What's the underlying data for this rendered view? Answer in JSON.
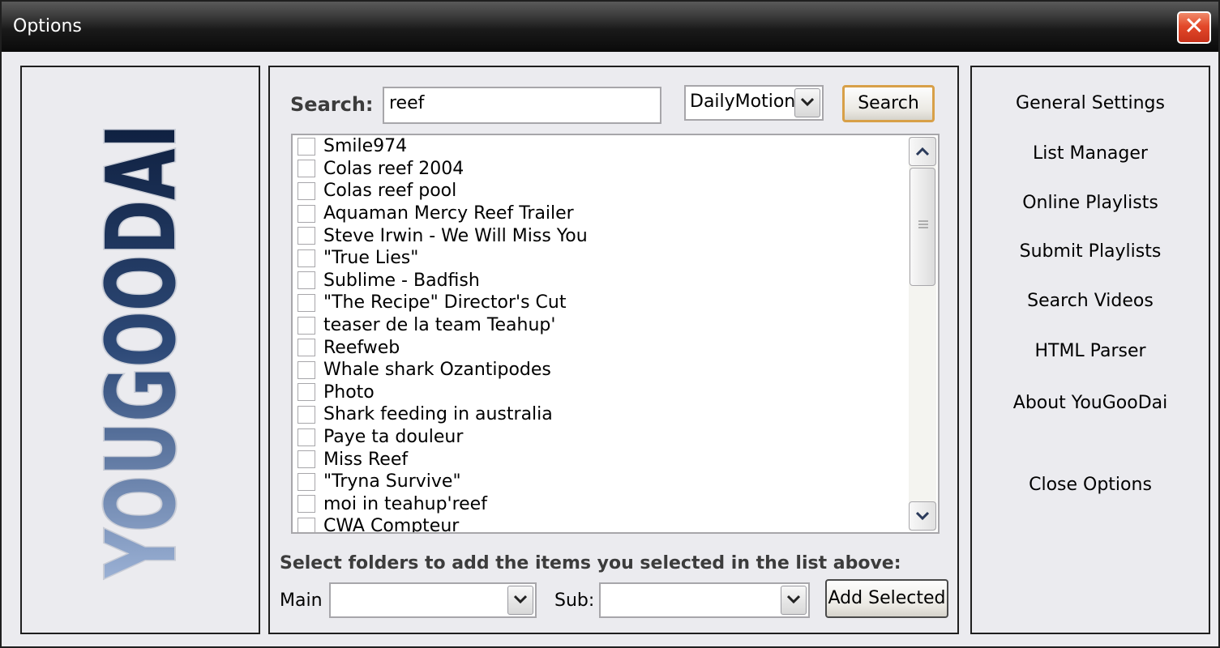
{
  "window": {
    "title": "Options"
  },
  "logo": {
    "text": "YOUGOODAI"
  },
  "search": {
    "label": "Search:",
    "query": "reef",
    "source": "DailyMotion",
    "button_label": "Search"
  },
  "results": [
    "Smile974",
    "Colas reef 2004",
    "Colas reef pool",
    "Aquaman Mercy Reef Trailer",
    "Steve Irwin - We Will Miss You",
    "\"True Lies\"",
    "Sublime - Badfish",
    "\"The Recipe\" Director's Cut",
    "teaser de la team Teahup'",
    "Reefweb",
    "Whale shark Ozantipodes",
    "Photo",
    "Shark feeding in australia",
    "Paye ta douleur",
    "Miss Reef",
    "\"Tryna Survive\"",
    "moi in teahup'reef",
    "CWA Compteur"
  ],
  "folders": {
    "instruction": "Select folders to add the items you selected in the list above:",
    "main_label": "Main",
    "main_value": "",
    "sub_label": "Sub:",
    "sub_value": "",
    "add_label": "Add Selected"
  },
  "menu": {
    "general": "General Settings",
    "list_manager": "List Manager",
    "online_playlists": "Online Playlists",
    "submit_playlists": "Submit Playlists",
    "search_videos": "Search Videos",
    "html_parser": "HTML Parser",
    "about": "About YouGooDai",
    "close": "Close Options"
  }
}
